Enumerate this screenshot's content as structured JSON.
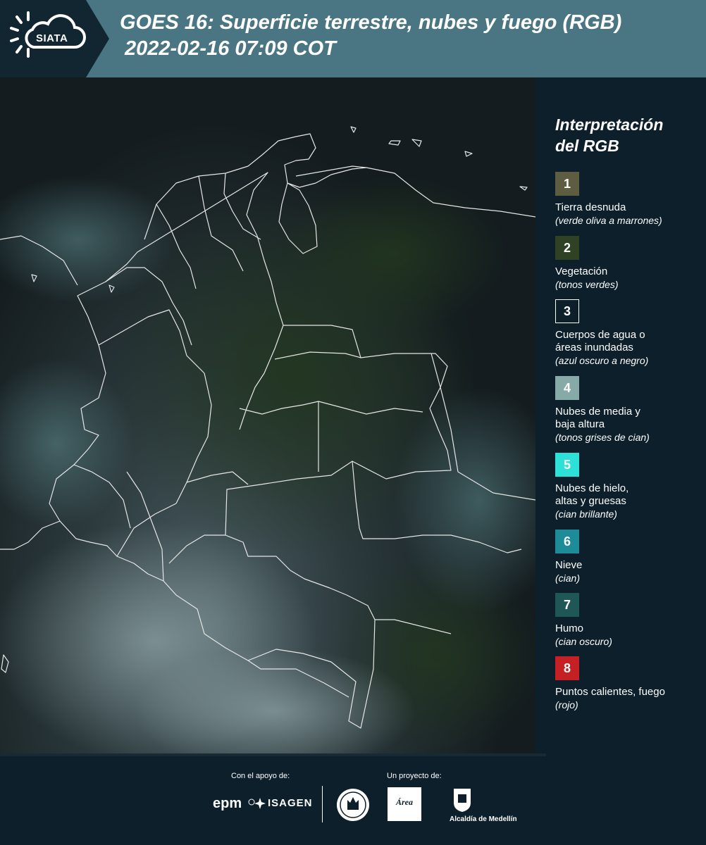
{
  "header": {
    "logo_text": "SIATA",
    "title_line1": "GOES 16: Superficie terrestre, nubes y fuego (RGB)",
    "title_line2": "2022-02-16 07:09 COT"
  },
  "legend": {
    "title_line1": "Interpretación",
    "title_line2": "del RGB",
    "items": [
      {
        "number": "1",
        "color": "#5e5d42",
        "label_lines": [
          "Tierra desnuda"
        ],
        "sub": "(verde oliva a marrones)"
      },
      {
        "number": "2",
        "color": "#2f4324",
        "label_lines": [
          "Vegetación"
        ],
        "sub": "(tonos verdes)"
      },
      {
        "number": "3",
        "color": "#0c1f2b",
        "label_lines": [
          "Cuerpos de agua o",
          "áreas inundadas"
        ],
        "sub": "(azul oscuro a negro)"
      },
      {
        "number": "4",
        "color": "#86aaa8",
        "label_lines": [
          "Nubes de media y",
          "baja altura"
        ],
        "sub": "(tonos grises de cian)"
      },
      {
        "number": "5",
        "color": "#2de0d8",
        "label_lines": [
          "Nubes de hielo,",
          "altas y gruesas"
        ],
        "sub": "(cian brillante)"
      },
      {
        "number": "6",
        "color": "#1e8b99",
        "label_lines": [
          "Nieve"
        ],
        "sub": "(cian)"
      },
      {
        "number": "7",
        "color": "#1f5656",
        "label_lines": [
          "Humo"
        ],
        "sub": "(cian oscuro)"
      },
      {
        "number": "8",
        "color": "#c42025",
        "label_lines": [
          "Puntos calientes, fuego"
        ],
        "sub": "(rojo)"
      }
    ]
  },
  "footer": {
    "support_label": "Con el apoyo de:",
    "project_label": "Un proyecto de:",
    "sponsors": [
      "epm",
      "ISAGEN"
    ],
    "area_logo_text": "Área",
    "alcaldia_label": "Alcaldía de Medellín"
  }
}
